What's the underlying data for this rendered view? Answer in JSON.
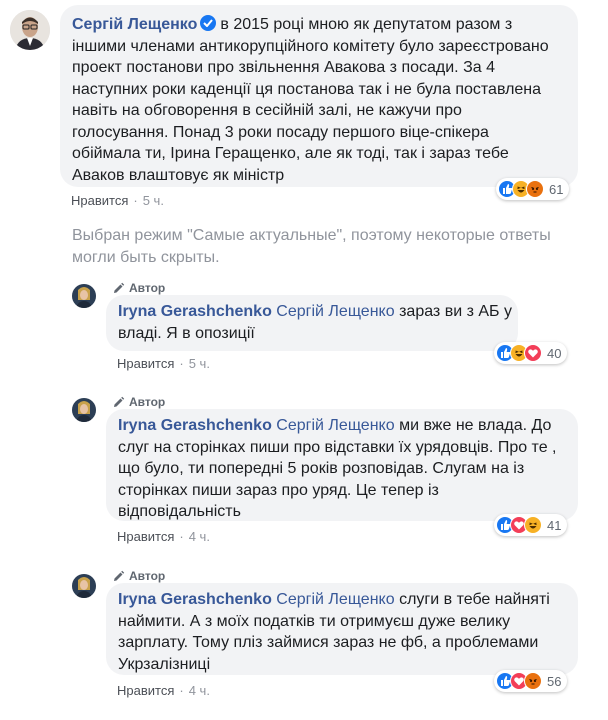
{
  "colors": {
    "link": "#385898",
    "bubble": "#f2f3f5",
    "meta": "#90949c",
    "like": "#1877f2",
    "haha": "#f7b125",
    "angry": "#e9710f",
    "love": "#f33e58"
  },
  "main_comment": {
    "author": "Сергій Лещенко",
    "verified": true,
    "lines": [
      "в 2015 році мною як депутатом разом з",
      "іншими членами антикорупційного комітету було зареєстровано",
      "проект постанови про звільнення Авакова з посади. За 4",
      "наступних роки каденції ця постанова так і не була поставлена",
      "навіть на обговорення в сесійній залі, не кажучи про",
      "голосування. Понад 3 роки посаду першого віце-спікера",
      "обіймала ти, Ірина Геращенко, але як тоді, так і зараз тебе",
      "Аваков влаштовує як міністр"
    ],
    "like_label": "Нравится",
    "time": "5 ч.",
    "reactions": {
      "icons": [
        "like-icon",
        "haha-icon",
        "angry-icon"
      ],
      "count": "61"
    }
  },
  "notice": "Выбран режим \"Самые актуальные\", поэтому некоторые ответы могли быть скрыты.",
  "replies": [
    {
      "badge": "Автор",
      "author": "Iryna Gerashchenko",
      "tag": "Сергій Лещенко",
      "lines_first": "зараз ви з АБ у",
      "lines": [
        "владі. Я в опозиції"
      ],
      "like_label": "Нравится",
      "time": "5 ч.",
      "reactions": {
        "icons": [
          "like-icon",
          "haha-icon",
          "love-icon"
        ],
        "count": "40"
      }
    },
    {
      "badge": "Автор",
      "author": "Iryna Gerashchenko",
      "tag": "Сергій Лещенко",
      "lines_first": "ми вже не влада. До",
      "lines": [
        "слуг на сторінках пиши про відставки їх урядовців. Про те ,",
        "що було, ти попередні 5 років розповідав. Слугам на із",
        "сторінках пиши зараз про уряд. Це тепер із",
        "відповідальність"
      ],
      "like_label": "Нравится",
      "time": "4 ч.",
      "reactions": {
        "icons": [
          "like-icon",
          "love-icon",
          "haha-icon"
        ],
        "count": "41"
      }
    },
    {
      "badge": "Автор",
      "author": "Iryna Gerashchenko",
      "tag": "Сергій Лещенко",
      "lines_first": "слуги в тебе найняті",
      "lines": [
        "наймити. А з моїх податків ти отримуєш дуже велику",
        "зарплату. Тому пліз займися зараз не фб, а проблемами",
        "Укрзалізниці"
      ],
      "like_label": "Нравится",
      "time": "4 ч.",
      "reactions": {
        "icons": [
          "like-icon",
          "love-icon",
          "angry-icon"
        ],
        "count": "56"
      }
    }
  ]
}
